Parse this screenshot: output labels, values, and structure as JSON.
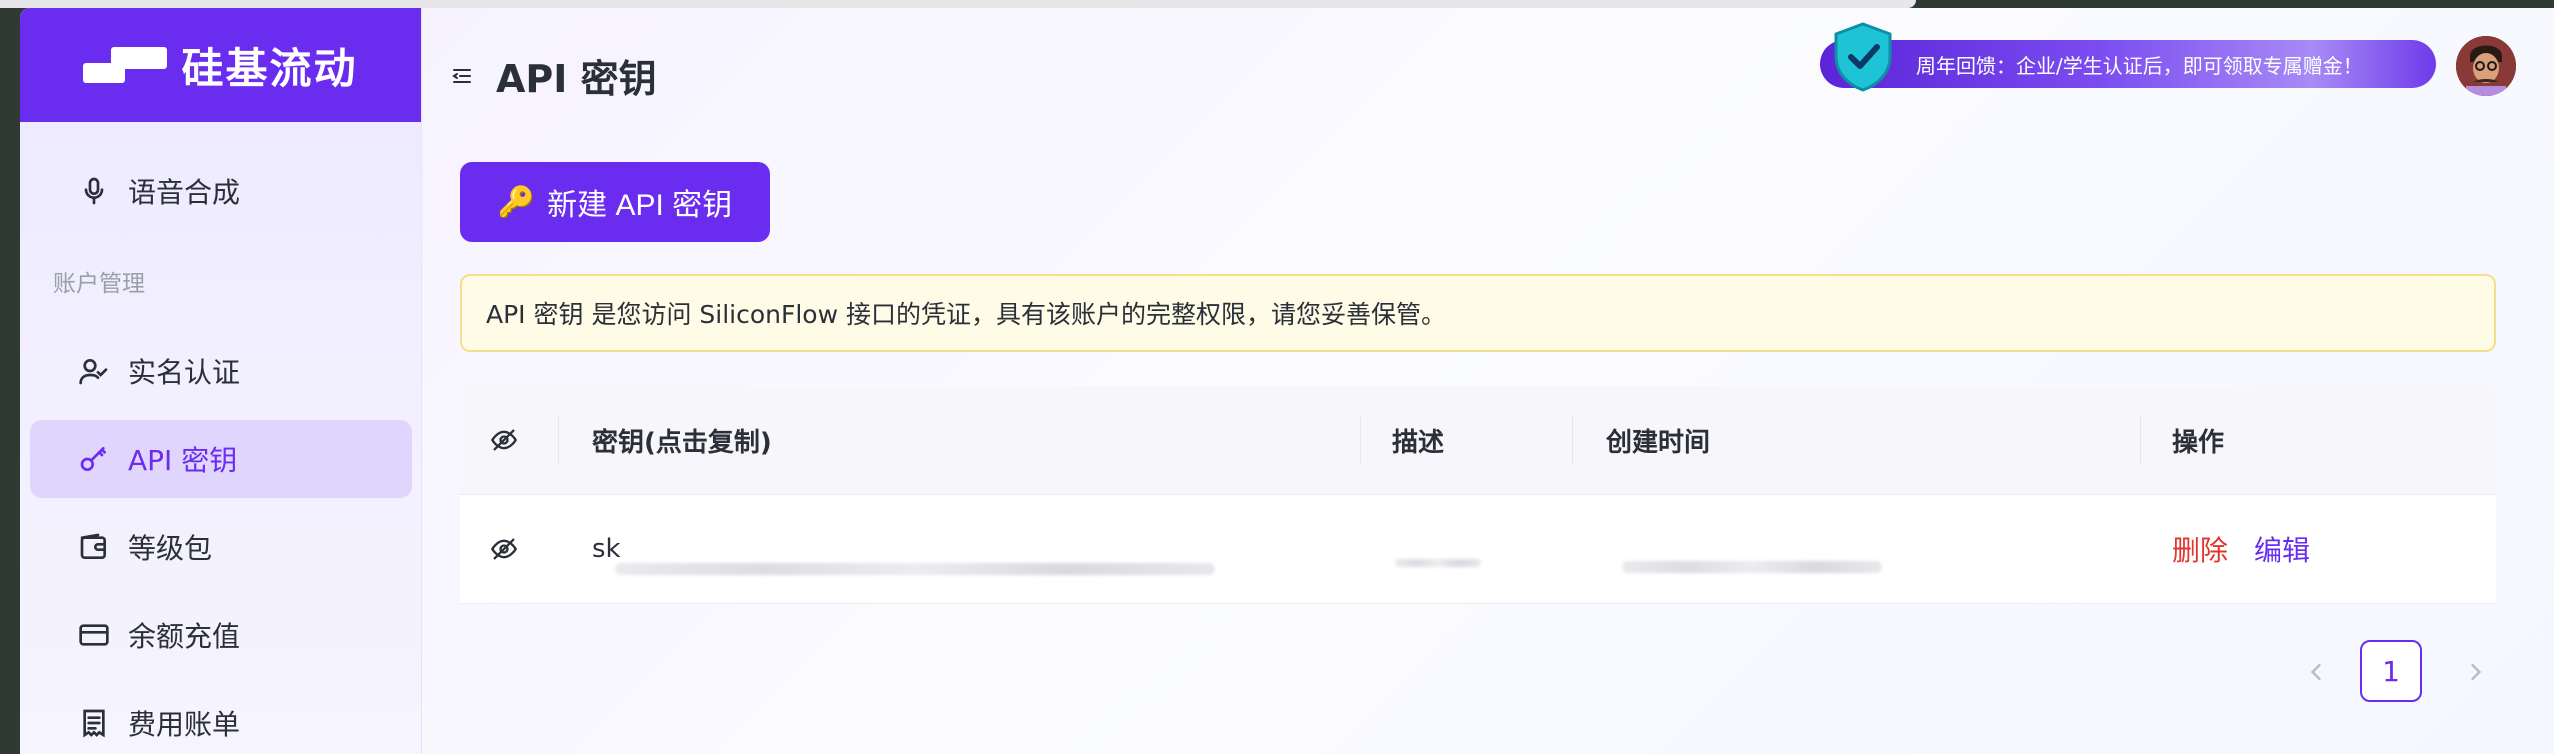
{
  "brand": {
    "name": "硅基流动"
  },
  "sidebar": {
    "items": [
      {
        "label": "语音合成",
        "icon": "microphone-icon"
      },
      {
        "label": "实名认证",
        "icon": "user-check-icon"
      },
      {
        "label": "API 密钥",
        "icon": "key-icon",
        "active": true
      },
      {
        "label": "等级包",
        "icon": "wallet-icon"
      },
      {
        "label": "余额充值",
        "icon": "credit-card-icon"
      },
      {
        "label": "费用账单",
        "icon": "receipt-icon"
      }
    ],
    "section_label": "账户管理"
  },
  "header": {
    "title": "API 密钥",
    "promo_text": "周年回馈：企业/学生认证后，即可领取专属赠金！"
  },
  "actions": {
    "create_label": "新建 API 密钥"
  },
  "notice": {
    "text": "API 密钥 是您访问 SiliconFlow 接口的凭证，具有该账户的完整权限，请您妥善保管。"
  },
  "table": {
    "columns": [
      "密钥(点击复制)",
      "描述",
      "创建时间",
      "操作"
    ],
    "rows": [
      {
        "key_prefix": "sk",
        "delete_label": "删除",
        "edit_label": "编辑"
      }
    ]
  },
  "pagination": {
    "current_page": "1"
  },
  "colors": {
    "accent": "#6a2df0",
    "danger": "#e0362f",
    "notice_bg": "#fefbe7"
  }
}
